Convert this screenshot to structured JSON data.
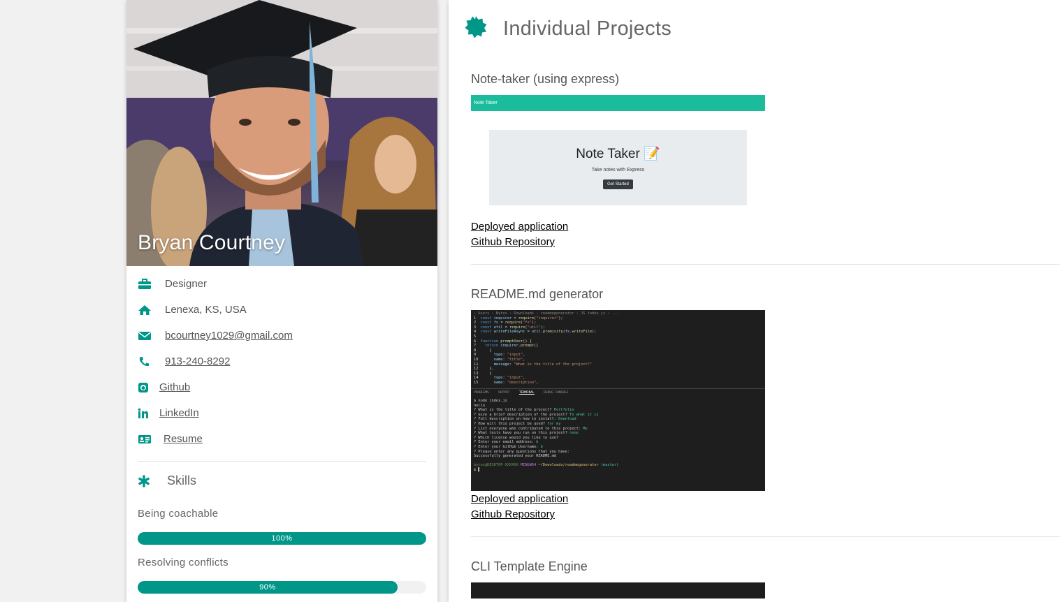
{
  "profile": {
    "name": "Bryan Courtney",
    "info": [
      {
        "icon": "briefcase-icon",
        "text": "Designer"
      },
      {
        "icon": "home-icon",
        "text": "Lenexa, KS, USA"
      },
      {
        "icon": "envelope-icon",
        "text": "bcourtney1029@gmail.com"
      },
      {
        "icon": "phone-icon",
        "text": "913-240-8292"
      },
      {
        "icon": "github-icon",
        "text": "Github"
      },
      {
        "icon": "linkedin-icon",
        "text": "LinkedIn"
      },
      {
        "icon": "id-card-icon",
        "text": "Resume"
      }
    ],
    "skills_title": "Skills",
    "skills": [
      {
        "label": "Being coachable",
        "percent": 100,
        "display": "100%"
      },
      {
        "label": "Resolving conflicts",
        "percent": 90,
        "display": "90%"
      }
    ]
  },
  "projects_section": {
    "title": "Individual Projects",
    "projects": [
      {
        "title": "Note-taker (using express)",
        "preview": {
          "bar": "Note Taker",
          "heading": "Note Taker 📝",
          "sub": "Take notes with Express",
          "button": "Get Started"
        },
        "links": [
          "Deployed application",
          "Github Repository"
        ]
      },
      {
        "title": "README.md generator",
        "links": [
          "Deployed application",
          "Github Repository"
        ]
      },
      {
        "title": "CLI Template Engine"
      }
    ]
  },
  "colors": {
    "accent": "#009688",
    "note_taker_bar": "#1bbc9b"
  }
}
